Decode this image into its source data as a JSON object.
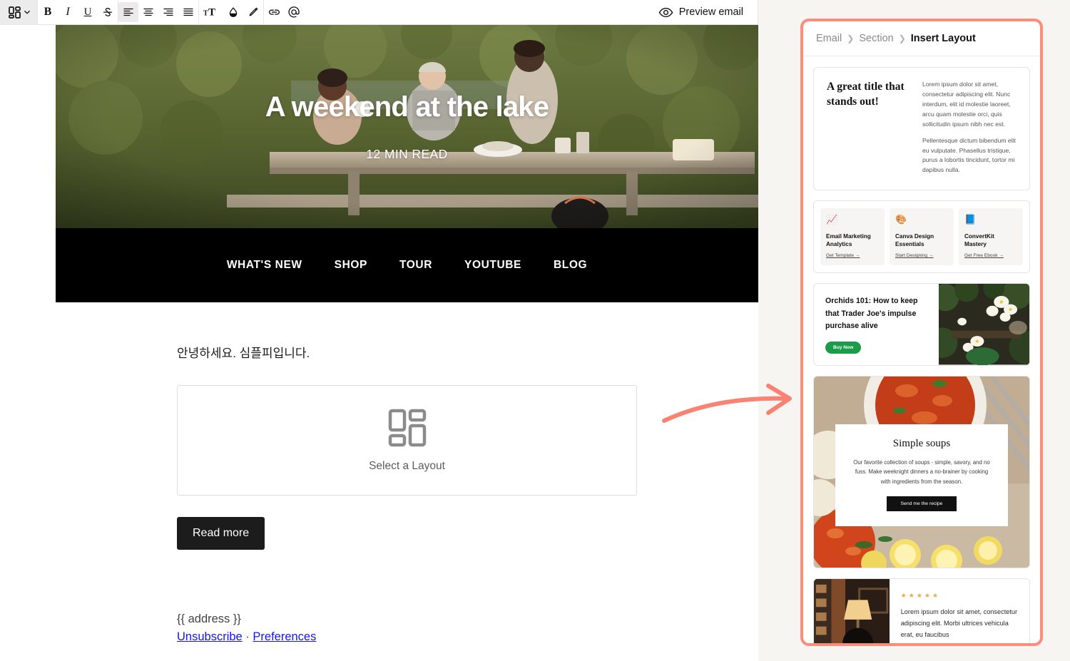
{
  "toolbar": {
    "layout_dropdown": "layout-selector",
    "buttons": [
      {
        "name": "bold-button",
        "glyph": "B"
      },
      {
        "name": "italic-button",
        "glyph": "I"
      },
      {
        "name": "underline-button",
        "glyph": "U"
      },
      {
        "name": "strikethrough-button",
        "glyph": "S"
      }
    ],
    "align_buttons": [
      {
        "name": "align-left-button"
      },
      {
        "name": "align-center-button"
      },
      {
        "name": "align-right-button"
      },
      {
        "name": "align-justify-button"
      }
    ],
    "format_buttons": [
      {
        "name": "font-size-button",
        "glyph": "ᴛT"
      },
      {
        "name": "text-color-button",
        "glyph": "◑"
      },
      {
        "name": "highlight-button",
        "glyph": "✐"
      }
    ],
    "insert_buttons": [
      {
        "name": "link-button",
        "glyph": "⚭"
      },
      {
        "name": "mention-button",
        "glyph": "@"
      }
    ],
    "preview_label": "Preview email"
  },
  "email": {
    "hero": {
      "title": "A weekend at the lake",
      "subtitle": "12 MIN READ"
    },
    "nav": [
      "WHAT'S NEW",
      "SHOP",
      "TOUR",
      "YOUTUBE",
      "BLOG"
    ],
    "greeting": "안녕하세요. 심플피입니다.",
    "layout_slot_label": "Select a Layout",
    "read_more_label": "Read more",
    "footer": {
      "address": "{{ address }}",
      "unsubscribe": "Unsubscribe",
      "separator": "·",
      "preferences": "Preferences"
    }
  },
  "panel": {
    "breadcrumb": {
      "email": "Email",
      "section": "Section",
      "current": "Insert Layout",
      "sep": "❯"
    },
    "accent_color": "#fa8d7c",
    "cards": {
      "title_text": {
        "title": "A great title that stands out!",
        "paragraph_1": "Lorem ipsum dolor sit amet, consectetur adipiscing elit. Nunc interdum, elit id molestie laoreet, arcu quam molestie orci, quis sollicitudin ipsum nibh nec est.",
        "paragraph_2": "Pellentesque dictum bibendum elit eu vulputate. Phasellus tristique, purus a lobortis tincidunt, tortor mi dapibus nulla."
      },
      "three_column": [
        {
          "icon": "📈",
          "icon_name": "chart-emoji-icon",
          "heading": "Email Marketing Analytics",
          "link": "Get Template →"
        },
        {
          "icon": "🎨",
          "icon_name": "palette-emoji-icon",
          "heading": "Canva Design Essentials",
          "link": "Start Designing →"
        },
        {
          "icon": "📘",
          "icon_name": "book-emoji-icon",
          "heading": "ConvertKit Mastery",
          "link": "Get Free Ebook →"
        }
      ],
      "orchids": {
        "heading": "Orchids 101:  How to keep that Trader Joe's impulse purchase alive",
        "button": "Buy Now",
        "button_color": "#1a9c48"
      },
      "soups": {
        "title": "Simple soups",
        "body": "Our favorite collection of soups - simple, savory, and no fuss. Make weeknight dinners a no-brainer by cooking with ingredients from the season.",
        "button": "Send me the recipe"
      },
      "testimonial": {
        "stars": "★★★★★",
        "star_color": "#f3a83a",
        "body": "Lorem ipsum dolor sit amet, consectetur adipiscing elit. Morbi ultrices vehicula erat, eu faucibus"
      }
    }
  }
}
